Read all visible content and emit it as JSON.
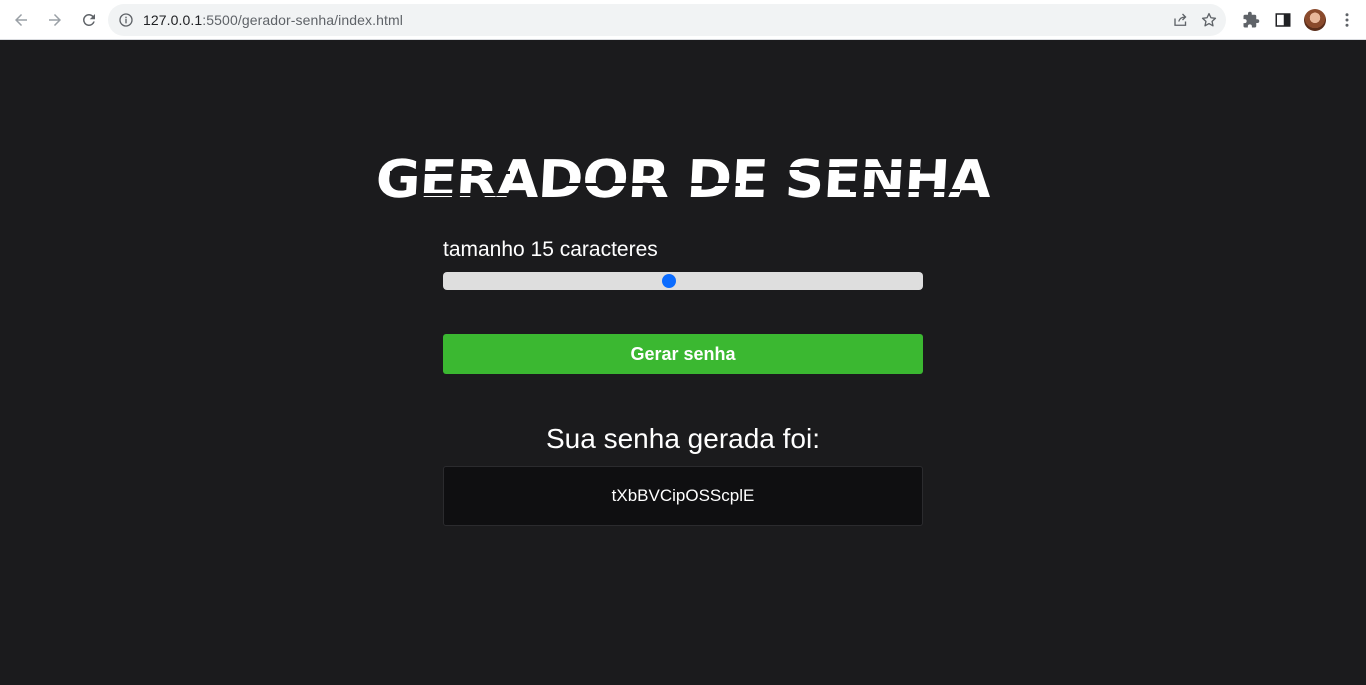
{
  "browser": {
    "url_host": "127.0.0.1",
    "url_rest": ":5500/gerador-senha/index.html",
    "icons": {
      "back": "arrow-left-icon",
      "forward": "arrow-right-icon",
      "reload": "reload-icon",
      "info": "info-icon",
      "share": "share-icon",
      "bookmark": "star-icon",
      "extensions": "puzzle-icon",
      "sidepanel": "side-panel-icon",
      "menu": "kebab-menu-icon"
    }
  },
  "page": {
    "title": "GERADOR DE SENHA",
    "length_label": "tamanho 15 caracteres",
    "slider": {
      "value": 15,
      "fraction": 0.47
    },
    "generate_button": "Gerar senha",
    "result_label": "Sua senha gerada foi:",
    "password": "tXbBVCipOSScplE"
  },
  "colors": {
    "background": "#1b1b1d",
    "button": "#3bb831",
    "slider_track": "#dedede",
    "slider_thumb": "#0b6cff",
    "result_box": "#0f0f11"
  }
}
